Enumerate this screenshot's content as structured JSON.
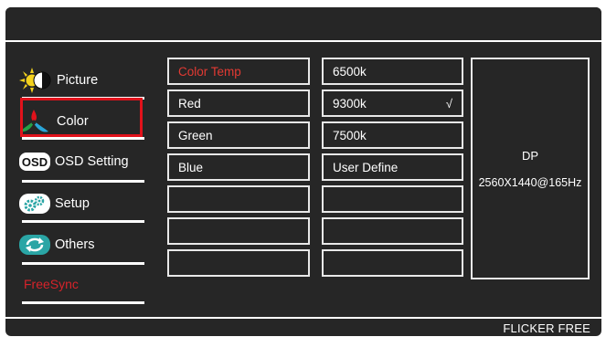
{
  "menu": {
    "items": [
      {
        "label": "Picture",
        "icon": "sun-contrast-icon"
      },
      {
        "label": "Color",
        "icon": "color-rgb-icon"
      },
      {
        "label": "OSD Setting",
        "icon": "osd-badge-icon"
      },
      {
        "label": "Setup",
        "icon": "gears-icon"
      },
      {
        "label": "Others",
        "icon": "refresh-arrows-icon"
      }
    ],
    "freesync": "FreeSync",
    "selected_color": "#e1121b"
  },
  "column1": {
    "items": [
      "Color Temp",
      "Red",
      "Green",
      "Blue"
    ],
    "active_index": 0
  },
  "column2": {
    "items": [
      "6500k",
      "9300k",
      "7500k",
      "User Define"
    ],
    "checked_index": 1,
    "check_mark": "√"
  },
  "info": {
    "source": "DP",
    "resolution": "2560X1440@165Hz"
  },
  "footer": {
    "flicker": "FLICKER FREE"
  },
  "colors": {
    "background": "#262626",
    "accent_red": "#e23a33",
    "line": "#ffffff"
  }
}
